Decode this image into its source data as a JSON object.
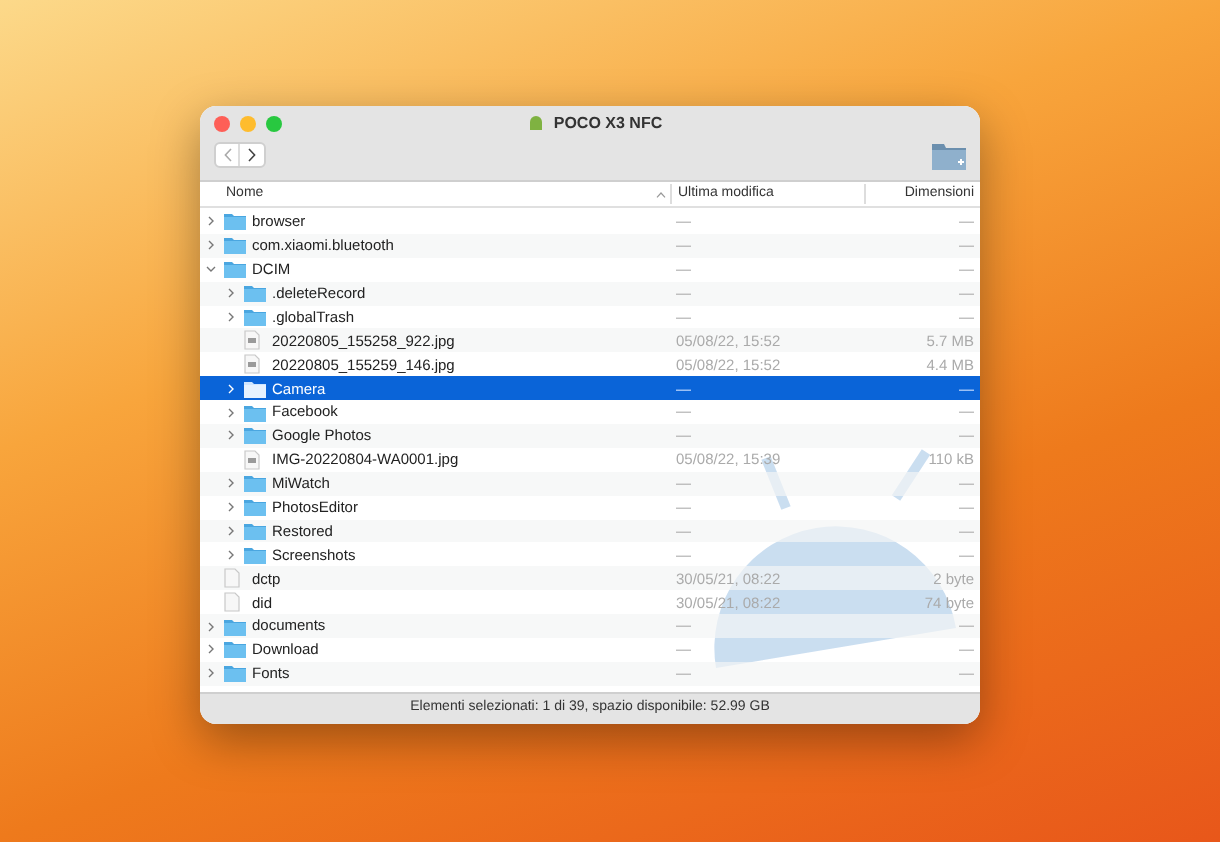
{
  "window": {
    "title": "POCO X3 NFC"
  },
  "columns": [
    {
      "label": "Nome",
      "sorted": true
    },
    {
      "label": "Ultima modifica",
      "sorted": false
    },
    {
      "label": "Dimensioni",
      "sorted": false
    }
  ],
  "rows": [
    {
      "kind": "folder",
      "name": "browser",
      "modified": "—",
      "size": "—",
      "expanded": false,
      "selected": false
    },
    {
      "kind": "folder",
      "name": "com.xiaomi.bluetooth",
      "modified": "—",
      "size": "—",
      "expanded": false,
      "selected": false
    },
    {
      "kind": "folder",
      "name": "DCIM",
      "modified": "—",
      "size": "—",
      "expanded": true,
      "selected": false,
      "children": [
        {
          "kind": "folder",
          "name": ".deleteRecord",
          "modified": "—",
          "size": "—",
          "expanded": false,
          "selected": false
        },
        {
          "kind": "folder",
          "name": ".globalTrash",
          "modified": "—",
          "size": "—",
          "expanded": false,
          "selected": false
        },
        {
          "kind": "image",
          "name": "20220805_155258_922.jpg",
          "modified": "05/08/22, 15:52",
          "size": "5.7 MB",
          "selected": false
        },
        {
          "kind": "image",
          "name": "20220805_155259_146.jpg",
          "modified": "05/08/22, 15:52",
          "size": "4.4 MB",
          "selected": false
        },
        {
          "kind": "folder",
          "name": "Camera",
          "modified": "—",
          "size": "—",
          "expanded": false,
          "selected": true
        },
        {
          "kind": "folder",
          "name": "Facebook",
          "modified": "—",
          "size": "—",
          "expanded": false,
          "selected": false
        },
        {
          "kind": "folder",
          "name": "Google Photos",
          "modified": "—",
          "size": "—",
          "expanded": false,
          "selected": false
        },
        {
          "kind": "image",
          "name": "IMG-20220804-WA0001.jpg",
          "modified": "05/08/22, 15:39",
          "size": "110 kB",
          "selected": false
        },
        {
          "kind": "folder",
          "name": "MiWatch",
          "modified": "—",
          "size": "—",
          "expanded": false,
          "selected": false
        },
        {
          "kind": "folder",
          "name": "PhotosEditor",
          "modified": "—",
          "size": "—",
          "expanded": false,
          "selected": false
        },
        {
          "kind": "folder",
          "name": "Restored",
          "modified": "—",
          "size": "—",
          "expanded": false,
          "selected": false
        },
        {
          "kind": "folder",
          "name": "Screenshots",
          "modified": "—",
          "size": "—",
          "expanded": false,
          "selected": false
        }
      ]
    },
    {
      "kind": "file",
      "name": "dctp",
      "modified": "30/05/21, 08:22",
      "size": "2 byte",
      "selected": false
    },
    {
      "kind": "file",
      "name": "did",
      "modified": "30/05/21, 08:22",
      "size": "74 byte",
      "selected": false
    },
    {
      "kind": "folder",
      "name": "documents",
      "modified": "—",
      "size": "—",
      "expanded": false,
      "selected": false
    },
    {
      "kind": "folder",
      "name": "Download",
      "modified": "—",
      "size": "—",
      "expanded": false,
      "selected": false
    },
    {
      "kind": "folder",
      "name": "Fonts",
      "modified": "—",
      "size": "—",
      "expanded": false,
      "selected": false
    }
  ],
  "status_bar": "Elementi selezionati: 1 di 39, spazio disponibile: 52.99 GB"
}
